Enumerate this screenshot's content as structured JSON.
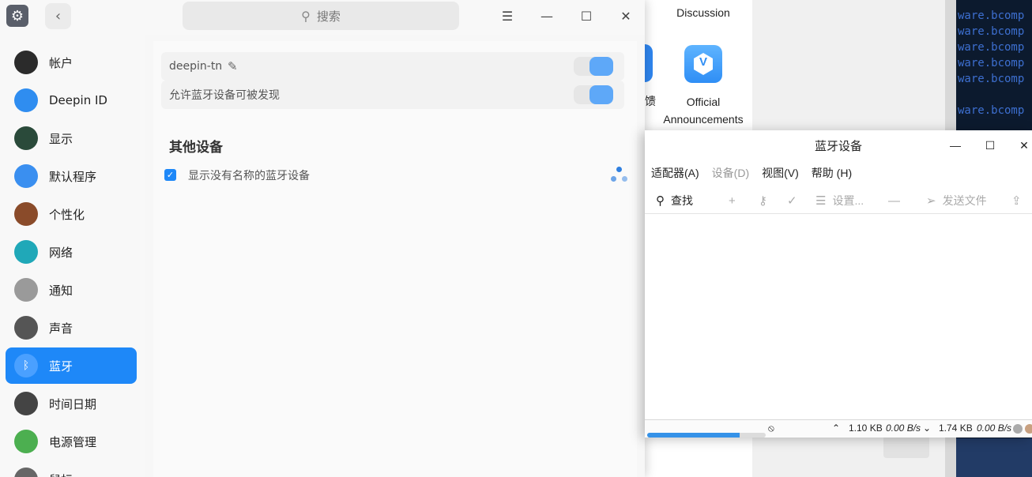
{
  "background_app": {
    "discussion_label": "Discussion",
    "feedback_partial": "馈",
    "announcements_label": "Official\nAnnouncements",
    "announcements_icon": "shield-v-icon"
  },
  "terminal": {
    "lines": [
      "ware.bcomp",
      "ware.bcomp",
      "ware.bcomp",
      "ware.bcomp",
      "ware.bcomp",
      "",
      "ware.bcomp"
    ]
  },
  "settings": {
    "search_placeholder": "搜索",
    "sidebar": [
      {
        "label": "帐户",
        "icon": "account-icon",
        "color": "#2b2b2b"
      },
      {
        "label": "Deepin ID",
        "icon": "cloud-icon",
        "color": "#2f8df0"
      },
      {
        "label": "显示",
        "icon": "display-icon",
        "color": "#2a4a3a"
      },
      {
        "label": "默认程序",
        "icon": "default-apps-icon",
        "color": "#3a8ff0"
      },
      {
        "label": "个性化",
        "icon": "personalization-icon",
        "color": "#8a4b2a"
      },
      {
        "label": "网络",
        "icon": "network-icon",
        "color": "#20a8b8"
      },
      {
        "label": "通知",
        "icon": "bell-icon",
        "color": "#9a9a9a"
      },
      {
        "label": "声音",
        "icon": "speaker-icon",
        "color": "#555555"
      },
      {
        "label": "蓝牙",
        "icon": "bluetooth-icon",
        "color": "#1e88f8",
        "active": true
      },
      {
        "label": "时间日期",
        "icon": "clock-icon",
        "color": "#444444"
      },
      {
        "label": "电源管理",
        "icon": "battery-icon",
        "color": "#4caf50"
      },
      {
        "label": "鼠标",
        "icon": "mouse-icon",
        "color": "#666666"
      }
    ],
    "device_name": "deepin-tn",
    "device_toggle_on": true,
    "discoverable_label": "允许蓝牙设备可被发现",
    "discoverable_on": true,
    "other_devices_title": "其他设备",
    "show_unnamed_label": "显示没有名称的蓝牙设备",
    "show_unnamed_checked": true
  },
  "bluetooth_window": {
    "title": "蓝牙设备",
    "menu": [
      {
        "label": "适配器(A)",
        "enabled": true
      },
      {
        "label": "设备(D)",
        "enabled": false
      },
      {
        "label": "视图(V)",
        "enabled": true
      },
      {
        "label": "帮助 (H)",
        "enabled": true
      }
    ],
    "toolbar": {
      "search_label": "查找",
      "settings_label": "设置...",
      "send_file_label": "发送文件"
    },
    "status": {
      "upload_rate": "1.10 KB",
      "upload_speed": "0.00 B/s",
      "download_rate": "1.74 KB",
      "download_speed": "0.00 B/s",
      "progress": 0.78
    }
  }
}
